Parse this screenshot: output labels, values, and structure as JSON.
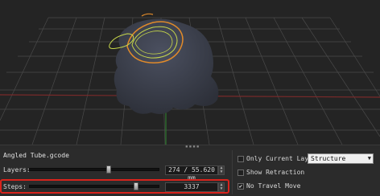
{
  "file": {
    "name": "Angled Tube.gcode"
  },
  "layers": {
    "label": "Layers:",
    "value": "274 / 55.620 mm",
    "progress": 0.62
  },
  "steps": {
    "label": "Steps:",
    "value": "3337",
    "progress": 0.84
  },
  "options": {
    "only_current_layer": {
      "label": "Only Current Layer",
      "checked": false
    },
    "show_retraction": {
      "label": "Show Retraction",
      "checked": false
    },
    "no_travel_move": {
      "label": "No Travel Move",
      "checked": true
    }
  },
  "view_mode": {
    "selected": "Structure"
  },
  "colors": {
    "highlight": "#d8231c",
    "toolpath_orange": "#e08a2a",
    "toolpath_yellow": "#c8d84a",
    "model": "#3b3f4a"
  }
}
